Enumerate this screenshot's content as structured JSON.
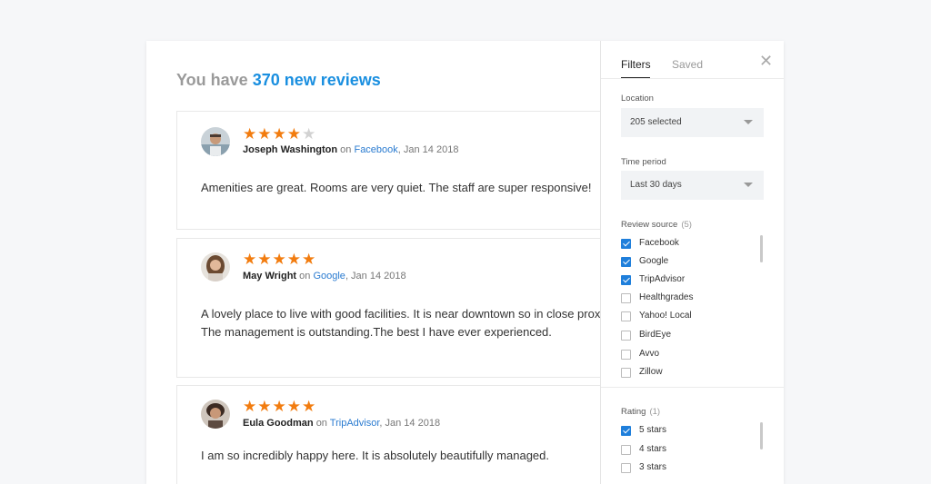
{
  "heading": {
    "prefix": "You have",
    "count": "370 new reviews"
  },
  "reviews": [
    {
      "name": "Joseph Washington",
      "on": "on",
      "source": "Facebook",
      "date": ", Jan 14 2018",
      "rating": 4,
      "line1": "Amenities are great.  Rooms are very quiet.  The staff are super responsive!",
      "line2": ""
    },
    {
      "name": "May Wright",
      "on": "on",
      "source": "Google",
      "date": ", Jan 14 2018",
      "rating": 5,
      "line1": "A lovely place to live with good facilities. It is near downtown so in close proximity",
      "line2": "The management is outstanding.The best I have ever experienced."
    },
    {
      "name": "Eula Goodman",
      "on": "on",
      "source": "TripAdvisor",
      "date": ", Jan 14 2018",
      "rating": 5,
      "line1": "I am so incredibly happy here. It is absolutely beautifully managed.",
      "line2": ""
    }
  ],
  "filters": {
    "tabs": [
      "Filters",
      "Saved"
    ],
    "close_icon": "close-icon",
    "location": {
      "label": "Location",
      "value": "205 selected"
    },
    "time_period": {
      "label": "Time period",
      "value": "Last 30 days"
    },
    "review_source": {
      "label": "Review source",
      "count": "(5)",
      "options": [
        {
          "label": "Facebook",
          "checked": true
        },
        {
          "label": "Google",
          "checked": true
        },
        {
          "label": "TripAdvisor",
          "checked": true
        },
        {
          "label": "Healthgrades",
          "checked": false
        },
        {
          "label": "Yahoo! Local",
          "checked": false
        },
        {
          "label": "BirdEye",
          "checked": false
        },
        {
          "label": "Avvo",
          "checked": false
        },
        {
          "label": "Zillow",
          "checked": false
        }
      ]
    },
    "rating": {
      "label": "Rating",
      "count": "(1)",
      "options": [
        {
          "label": "5 stars",
          "checked": true
        },
        {
          "label": "4 stars",
          "checked": false
        },
        {
          "label": "3 stars",
          "checked": false
        }
      ]
    }
  },
  "colors": {
    "accent": "#1a8fe0",
    "star": "#f27c0f",
    "link": "#2a7bd0",
    "checkbox": "#1f7fdb"
  }
}
